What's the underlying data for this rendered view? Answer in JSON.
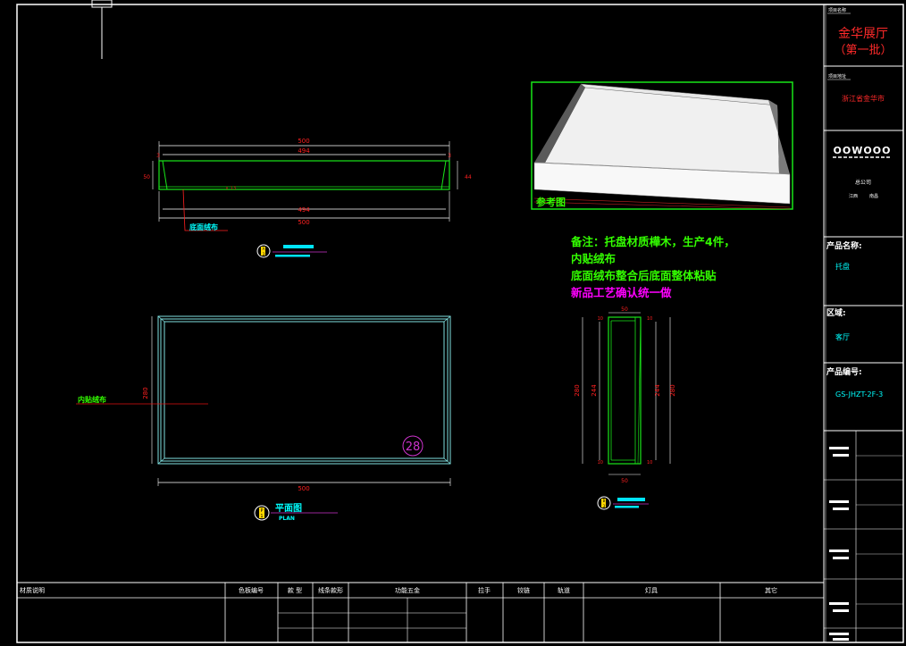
{
  "colors": {
    "background": "#000000",
    "frame": "#ffffff",
    "part": "#19e619",
    "dimension": "#ffffff",
    "dim_text": "#ff2020",
    "leader": "#e01010",
    "label": "#00ffff",
    "note_green": "#33ff00",
    "note_magenta": "#ff00ff",
    "callout": "#cc33cc",
    "title_accent": "#ff2a2a",
    "bar": "#00e5ff"
  },
  "title_block": {
    "project_name_label": "项目名称",
    "project_name_line1": "金华展厅",
    "project_name_line2": "（第一批）",
    "project_location_label": "项目地址",
    "project_location": "浙江省金华市",
    "logo_text": "OOWOOO",
    "company": "总公司",
    "company_sub1": "江西",
    "company_sub2": "南昌",
    "product_name_label": "产品名称:",
    "product_name": "托盘",
    "area_label": "区域:",
    "area": "客厅",
    "product_code_label": "产品编号:",
    "product_code": "GS-JHZT-2F-3"
  },
  "drawing": {
    "front_view": {
      "dim_total": "500",
      "dim_inner": "494",
      "dim_side": "3",
      "dim_height": "50",
      "dim_mid": "44",
      "leader_label": "底面绒布",
      "view_marker": "A",
      "view_marker_sub": "3"
    },
    "plan_view": {
      "dim_width": "500",
      "dim_height": "280",
      "leader_label": "内贴绒布",
      "callout_number": "28",
      "title": "平面图",
      "subtitle": "PLAN",
      "marker_main": "P",
      "marker_sub": "1"
    },
    "side_view": {
      "dim_top": "50",
      "dim_bottom": "50",
      "dim_height_outer": "280",
      "dim_height_inner": "244",
      "dim_small": "10",
      "marker_main": "B",
      "marker_sub": "3"
    },
    "reference": {
      "label": "参考图"
    },
    "notes": [
      "备注：托盘材质樺木，生产4件，",
      "内贴绒布",
      "底面绒布整合后底面整体粘贴",
      "新品工艺确认统一做"
    ]
  },
  "schedule": {
    "headers": [
      "材质说明",
      "色板编号",
      "款 型",
      "线条款形",
      "功能五金",
      "拉手",
      "铰链",
      "轨道",
      "灯具",
      "其它"
    ]
  }
}
